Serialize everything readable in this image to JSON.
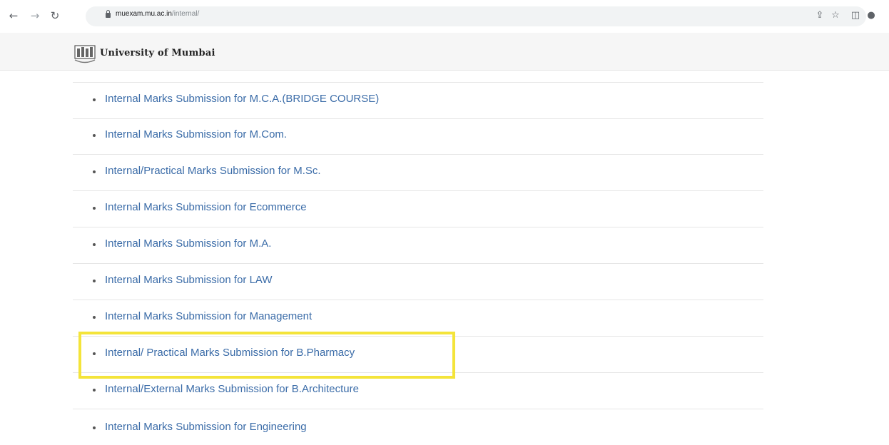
{
  "browser": {
    "url_host": "muexam.mu.ac.in",
    "url_path": "/internal/",
    "icons": [
      "back-arrow",
      "forward-arrow",
      "reload",
      "lock",
      "share",
      "star",
      "sidebar",
      "profile"
    ]
  },
  "header": {
    "title": "University of Mumbai"
  },
  "links": [
    "Internal Marks Submission for M.C.A.(BRIDGE COURSE)",
    "Internal Marks Submission for M.Com.",
    "Internal/Practical Marks Submission for M.Sc.",
    "Internal Marks Submission for Ecommerce",
    "Internal Marks Submission for M.A.",
    "Internal Marks Submission for LAW",
    "Internal Marks Submission for Management",
    "Internal/ Practical Marks Submission for B.Pharmacy",
    "Internal/External Marks Submission for B.Architecture",
    "Internal Marks Submission for Engineering"
  ],
  "colors": {
    "link": "#3b6ca8",
    "highlight": "#f4e43a"
  }
}
